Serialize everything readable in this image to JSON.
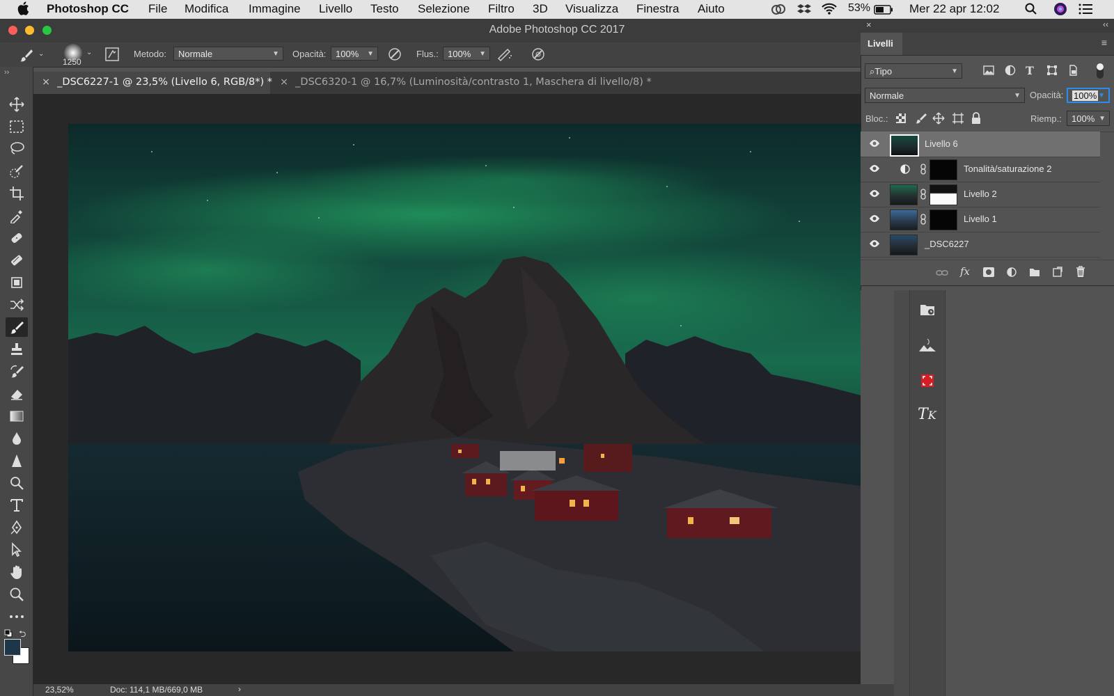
{
  "menubar": {
    "app": "Photoshop CC",
    "items": [
      "File",
      "Modifica",
      "Immagine",
      "Livello",
      "Testo",
      "Selezione",
      "Filtro",
      "3D",
      "Visualizza",
      "Finestra",
      "Aiuto"
    ],
    "battery": "53%",
    "datetime": "Mer 22 apr  12:02"
  },
  "window": {
    "title": "Adobe Photoshop CC 2017"
  },
  "options": {
    "brush_size": "1250",
    "mode_label": "Metodo:",
    "mode_value": "Normale",
    "opacity_label": "Opacità:",
    "opacity_value": "100%",
    "flow_label": "Flus.:",
    "flow_value": "100%"
  },
  "tabs": [
    {
      "label": "_DSC6227-1 @ 23,5% (Livello 6, RGB/8*) *",
      "active": true
    },
    {
      "label": "_DSC6320-1 @ 16,7% (Luminosità/contrasto 1, Maschera di livello/8) *",
      "active": false
    }
  ],
  "status": {
    "zoom": "23,52%",
    "doc": "Doc: 114,1 MB/669,0 MB"
  },
  "layers_panel": {
    "title": "Livelli",
    "filter_value": "Tipo",
    "blend_mode": "Normale",
    "opacity_label": "Opacità:",
    "opacity_value": "100%",
    "lock_label": "Bloc.:",
    "fill_label": "Riemp.:",
    "fill_value": "100%",
    "layers": [
      {
        "name": "Livello 6"
      },
      {
        "name": "Tonalità/saturazione 2"
      },
      {
        "name": "Livello 2"
      },
      {
        "name": "Livello 1"
      },
      {
        "name": "_DSC6227"
      }
    ]
  },
  "colors": {
    "accent": "#2d8ceb",
    "background": "#535353"
  }
}
